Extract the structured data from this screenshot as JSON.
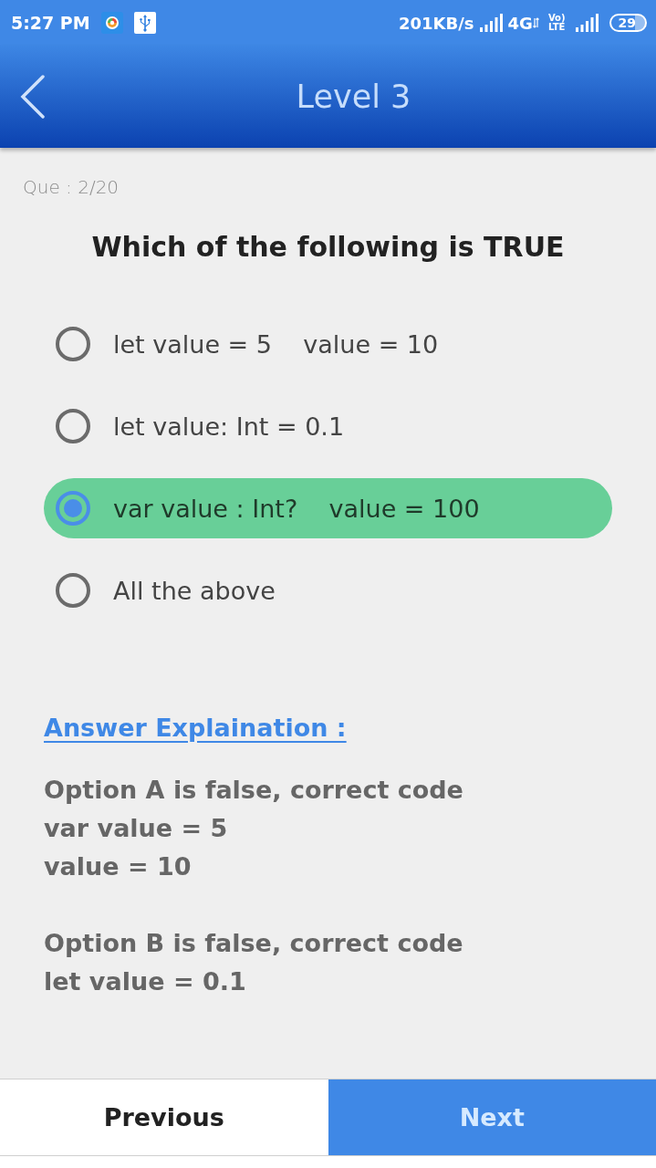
{
  "status_bar": {
    "time": "5:27 PM",
    "net_speed": "201KB/s",
    "network_type": "4G",
    "volte": [
      "Vo)",
      "LTE"
    ],
    "battery": "29"
  },
  "header": {
    "title": "Level 3"
  },
  "question": {
    "counter": "Que : 2/20",
    "text": "Which of the following is TRUE"
  },
  "options": [
    {
      "label": "let value = 5    value = 10",
      "selected": false
    },
    {
      "label": "let value: Int = 0.1",
      "selected": false
    },
    {
      "label": "var value : Int?    value = 100",
      "selected": true
    },
    {
      "label": "All the above",
      "selected": false
    }
  ],
  "explanation": {
    "heading": "Answer Explaination :",
    "paragraphs": [
      "Option A is false, correct code\nvar value = 5\nvalue = 10",
      "Option B is false, correct code\nlet value = 0.1"
    ]
  },
  "nav": {
    "previous": "Previous",
    "next": "Next"
  }
}
